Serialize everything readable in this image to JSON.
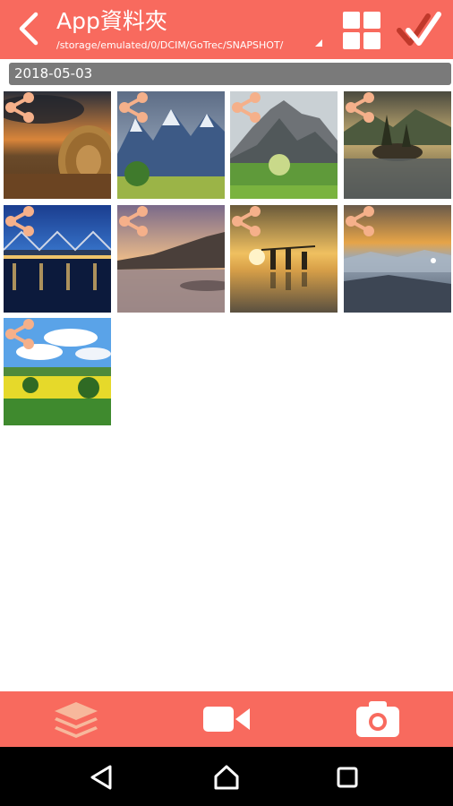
{
  "header": {
    "title": "App資料夾",
    "path": "/storage/emulated/0/DCIM/GoTrec/SNAPSHOT/",
    "back_icon": "chevron-left-icon",
    "grid_icon": "grid-view-icon",
    "select_icon": "double-check-icon"
  },
  "gallery": {
    "date": "2018-05-03",
    "photos": [
      {
        "subject": "hay bale at sunset"
      },
      {
        "subject": "snowy mountains with tree"
      },
      {
        "subject": "rocky mountain meadow"
      },
      {
        "subject": "lake island with trees"
      },
      {
        "subject": "bridge at night"
      },
      {
        "subject": "coastal cliffs at sunset"
      },
      {
        "subject": "fishermen at sunrise"
      },
      {
        "subject": "misty valley at dawn"
      },
      {
        "subject": "yellow fields under blue sky"
      }
    ]
  },
  "bottom_bar": {
    "items": [
      {
        "icon": "layers-icon"
      },
      {
        "icon": "video-camera-icon"
      },
      {
        "icon": "camera-icon"
      }
    ]
  },
  "system_nav": {
    "items": [
      {
        "icon": "back-triangle-icon"
      },
      {
        "icon": "home-icon"
      },
      {
        "icon": "recents-icon"
      }
    ]
  },
  "colors": {
    "accent": "#f86a5e",
    "share_icon": "#f5b08a",
    "date_bar": "#7a7a7a"
  }
}
